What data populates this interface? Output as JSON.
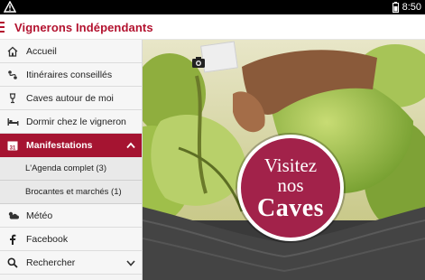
{
  "status_bar": {
    "time": "8:50",
    "icons": [
      "warning-icon",
      "battery-icon"
    ]
  },
  "app_bar": {
    "title": "Vignerons Indépendants",
    "menu_icon": "hamburger-icon"
  },
  "drawer": {
    "items": [
      {
        "label": "Accueil",
        "icon": "home-icon"
      },
      {
        "label": "Itinéraires conseillés",
        "icon": "route-icon"
      },
      {
        "label": "Caves autour de moi",
        "icon": "wine-glass-icon"
      },
      {
        "label": "Dormir chez le vigneron",
        "icon": "bed-icon"
      },
      {
        "label": "Manifestations",
        "icon": "calendar-icon",
        "active": true
      },
      {
        "label": "Météo",
        "icon": "weather-icon"
      },
      {
        "label": "Facebook",
        "icon": "facebook-icon"
      },
      {
        "label": "Rechercher",
        "icon": "search-icon"
      }
    ],
    "subitems": [
      {
        "label": "L'Agenda complet (3)"
      },
      {
        "label": "Brocantes et marchés (1)"
      }
    ]
  },
  "banner": {
    "line1": "Visitez",
    "line2": "nos",
    "line3": "Caves"
  },
  "colors": {
    "brand": "#a51431",
    "badge": "#a2224a"
  }
}
